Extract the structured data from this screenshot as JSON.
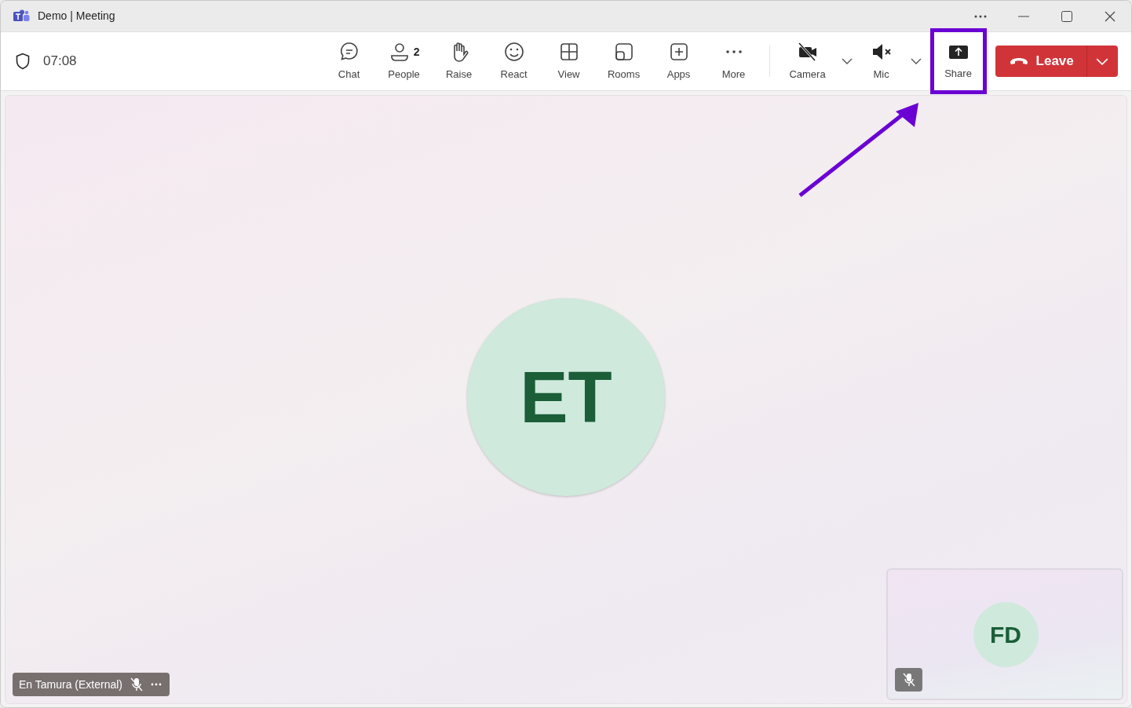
{
  "window": {
    "title": "Demo | Meeting"
  },
  "meeting": {
    "timer": "07:08"
  },
  "toolbar": [
    {
      "kind": "chat",
      "label": "Chat"
    },
    {
      "kind": "people",
      "label": "People",
      "badge": "2"
    },
    {
      "kind": "raise",
      "label": "Raise"
    },
    {
      "kind": "react",
      "label": "React"
    },
    {
      "kind": "view",
      "label": "View"
    },
    {
      "kind": "rooms",
      "label": "Rooms"
    },
    {
      "kind": "apps",
      "label": "Apps"
    },
    {
      "kind": "more",
      "label": "More"
    }
  ],
  "devices": [
    {
      "kind": "camera",
      "label": "Camera",
      "off": true
    },
    {
      "kind": "mic",
      "label": "Mic",
      "off": true
    }
  ],
  "share": {
    "label": "Share",
    "highlighted": true
  },
  "leave": {
    "label": "Leave"
  },
  "annotation": {
    "kind": "arrow"
  },
  "stage": {
    "initials": "ET",
    "name": "En Tamura (External)",
    "muted": true
  },
  "self_view": {
    "initials": "FD",
    "muted": true
  }
}
